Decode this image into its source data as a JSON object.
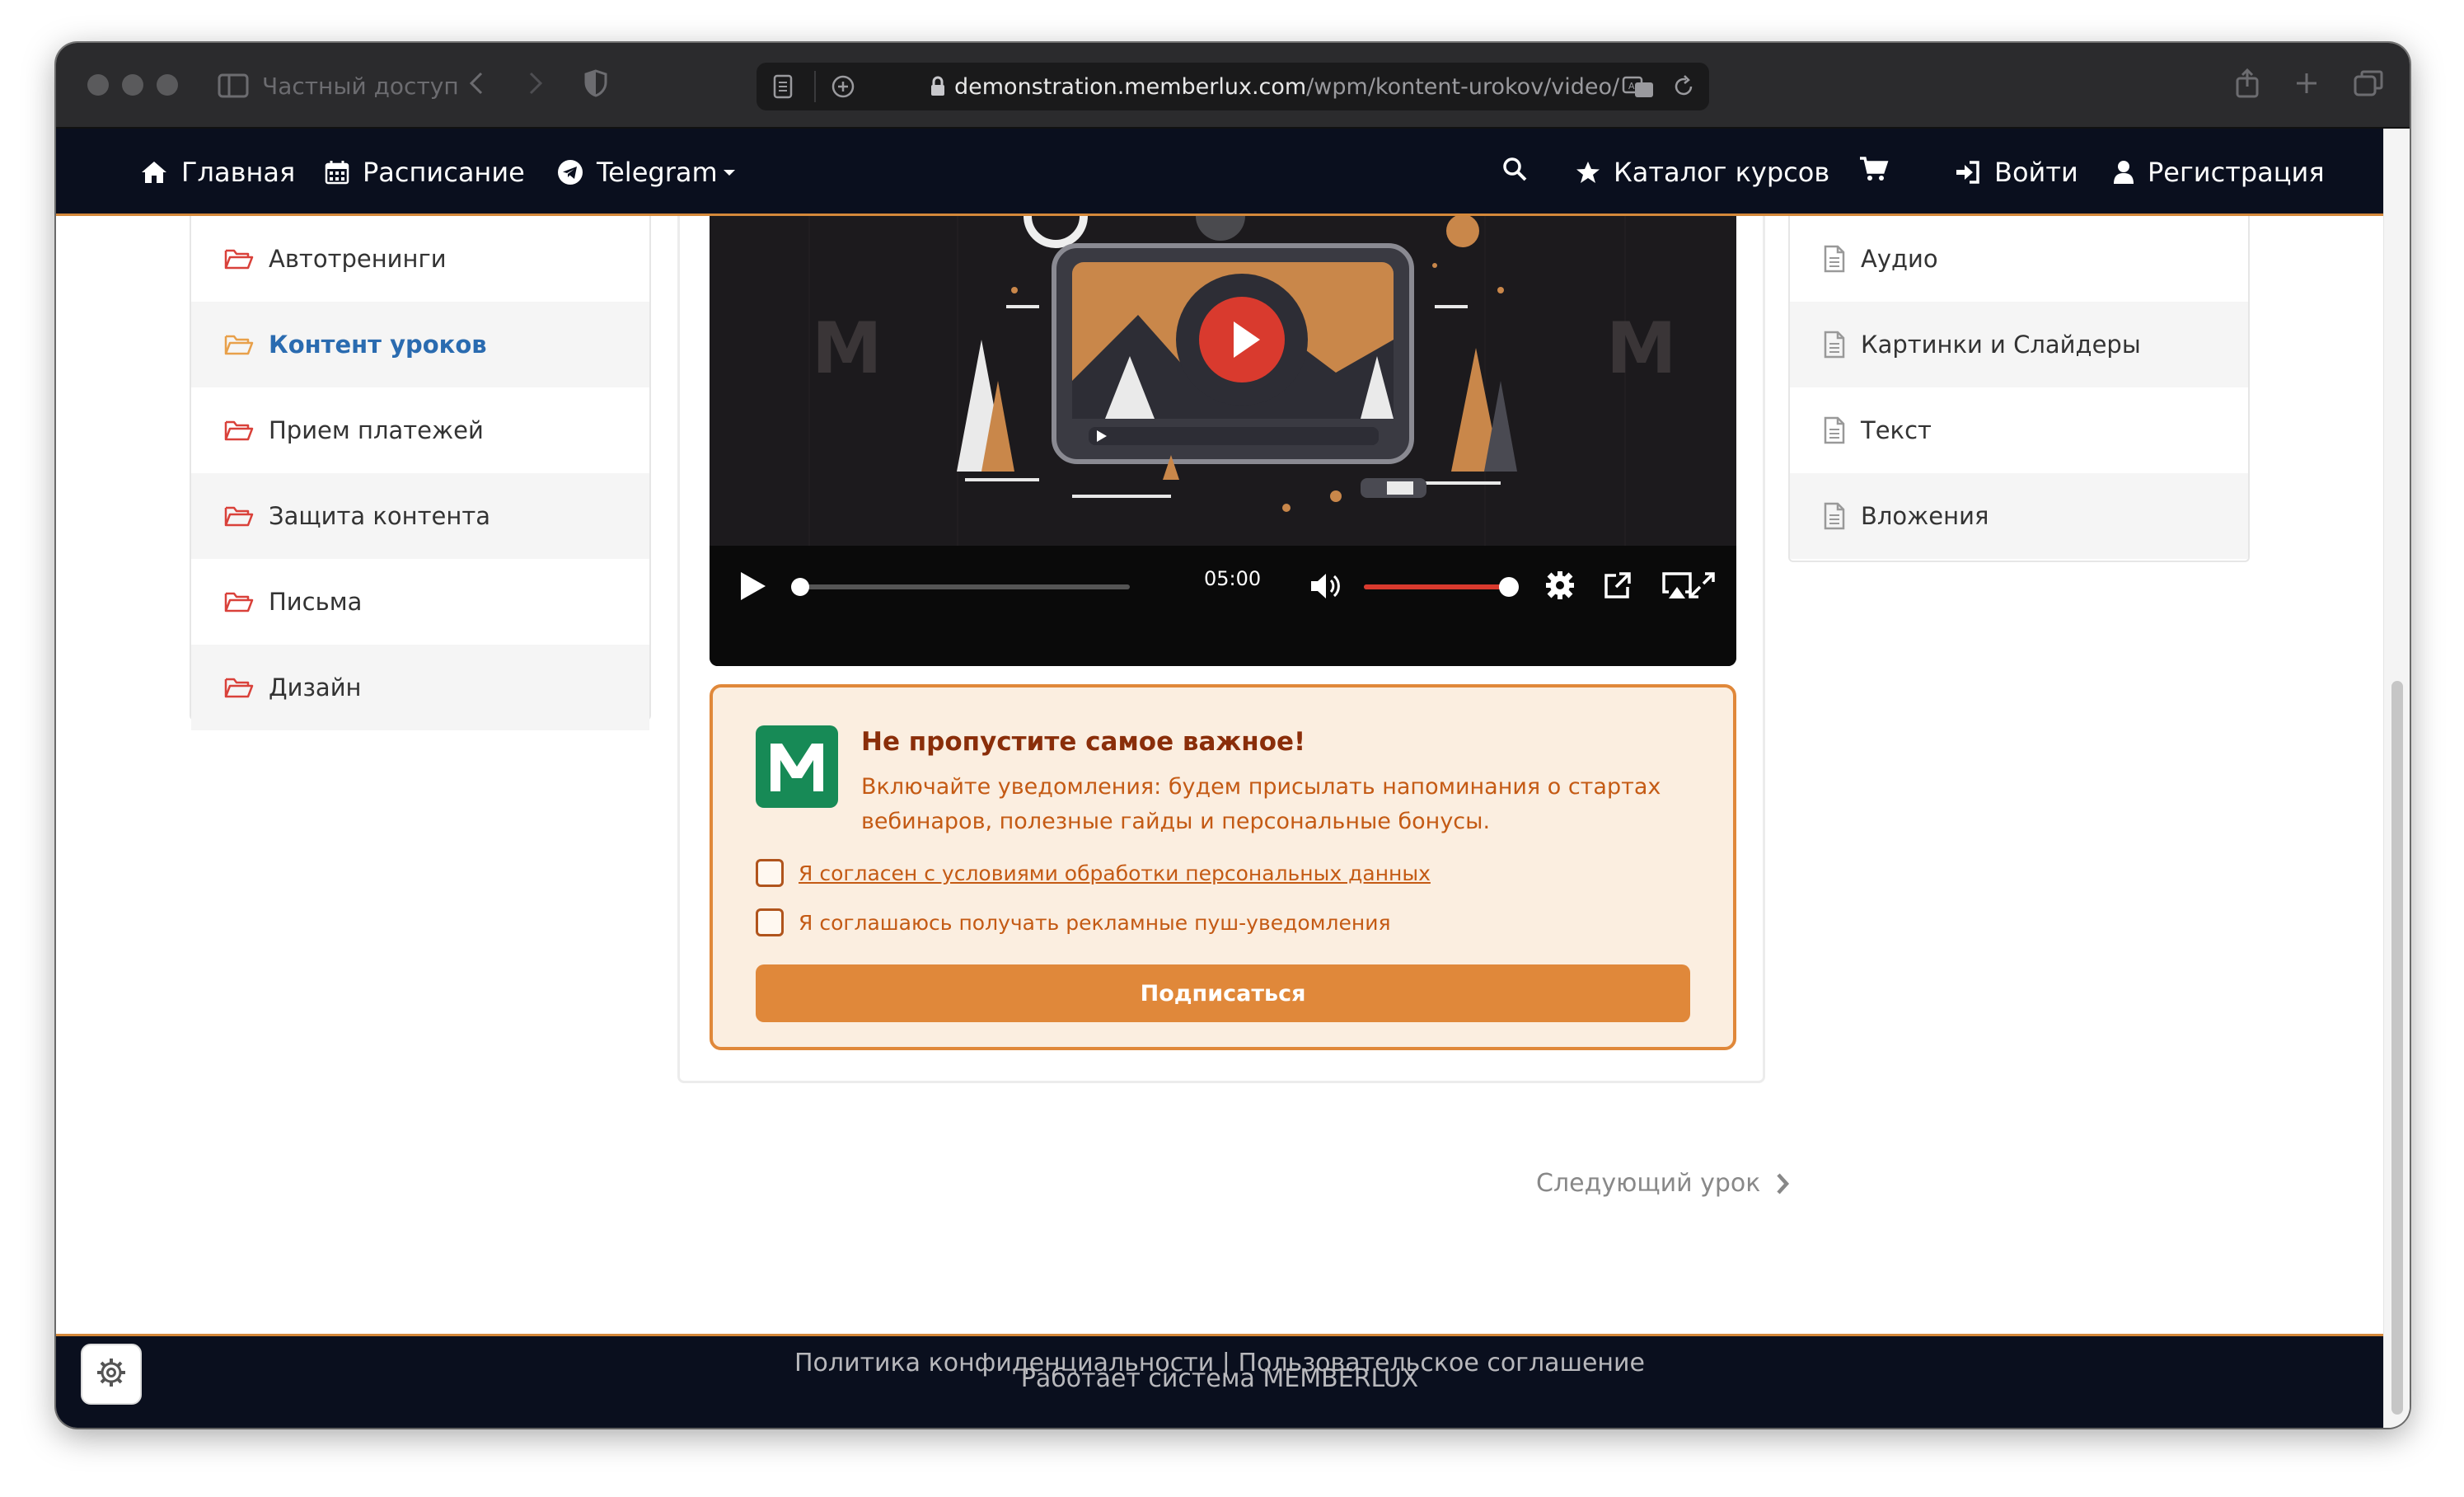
{
  "browser": {
    "private_label": "Частный доступ",
    "url_host": "demonstration.memberlux.com",
    "url_path": "/wpm/kontent-urokov/video/"
  },
  "nav": {
    "home": "Главная",
    "schedule": "Расписание",
    "telegram": "Telegram",
    "catalog": "Каталог курсов",
    "login": "Войти",
    "register": "Регистрация"
  },
  "left_menu": {
    "items": [
      {
        "label": "Автотренинги"
      },
      {
        "label": "Контент уроков"
      },
      {
        "label": "Прием платежей"
      },
      {
        "label": "Защита контента"
      },
      {
        "label": "Письма"
      },
      {
        "label": "Дизайн"
      }
    ]
  },
  "right_menu": {
    "items": [
      {
        "label": "Аудио"
      },
      {
        "label": "Картинки и Слайдеры"
      },
      {
        "label": "Текст"
      },
      {
        "label": "Вложения"
      }
    ]
  },
  "video": {
    "duration": "05:00",
    "progress_fraction": 0.0,
    "volume_fraction": 1.0
  },
  "notify": {
    "title": "Не пропустите самое важное!",
    "description": "Включайте уведомления: будем присылать напоминания о стартах вебинаров, полезные гайды и персональные бонусы.",
    "consent_label": "Я согласен с условиями обработки персональных данных",
    "ads_label": "Я соглашаюсь получать рекламные пуш-уведомления",
    "subscribe_label": "Подписаться"
  },
  "next_lesson": "Следующий урок",
  "footer": {
    "powered": "Работает система MEMBERLUX",
    "privacy": "Политика конфиденциальности",
    "separator": " | ",
    "terms": "Пользовательское соглашение"
  },
  "colors": {
    "nav_bg": "#0a0f1e",
    "accent_orange": "#e0883a",
    "active_link": "#2a6bb0",
    "folder_icon": "#d9413a",
    "folder_icon_active": "#e8a04a",
    "logo_green": "#178a56"
  }
}
